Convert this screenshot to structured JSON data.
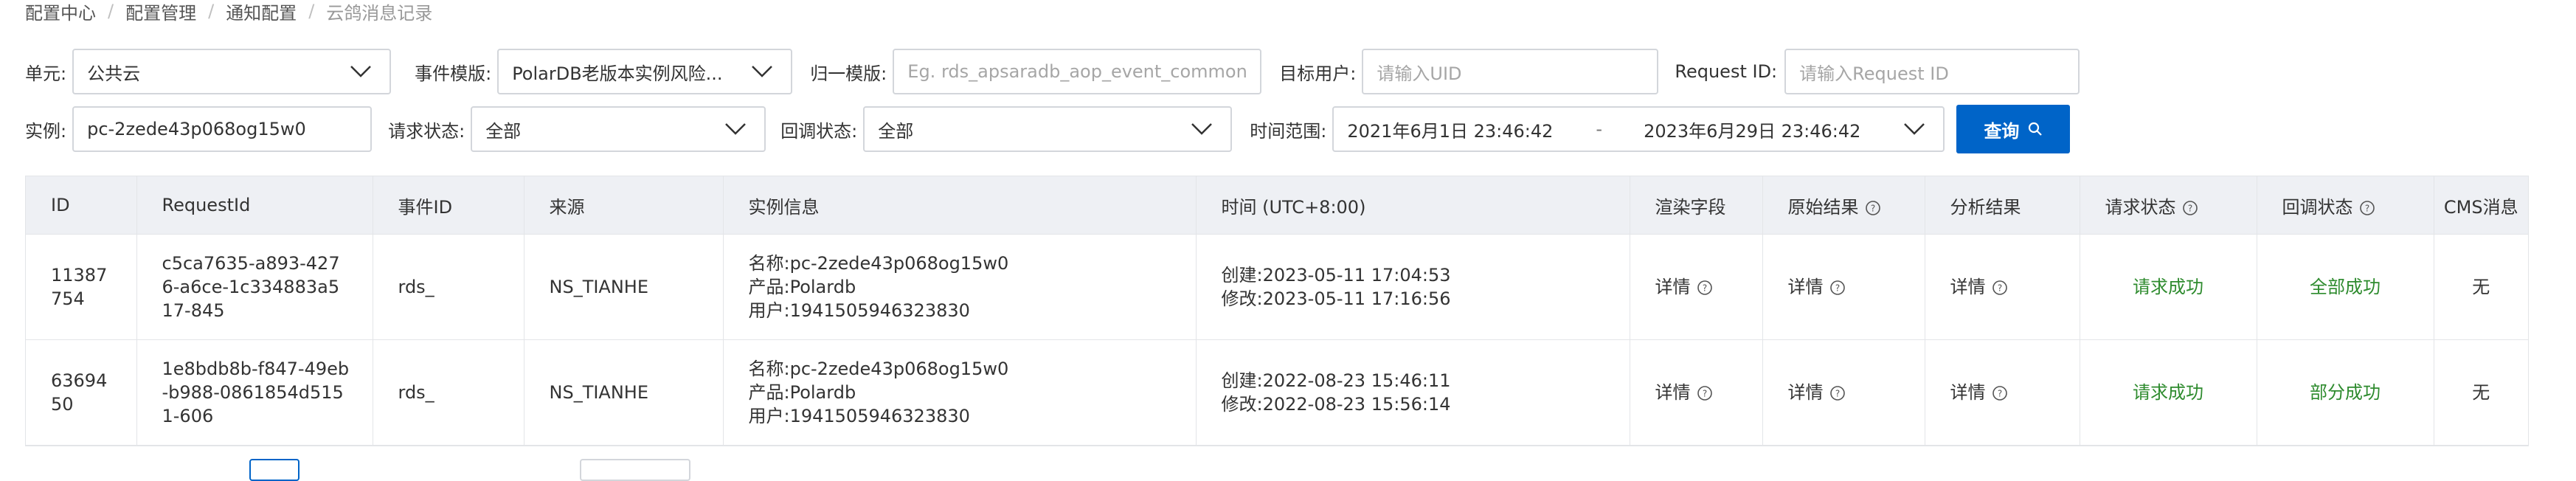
{
  "breadcrumb": [
    "配置中心",
    "配置管理",
    "通知配置",
    "云鸽消息记录"
  ],
  "filters": {
    "unit": {
      "label": "单元:",
      "value": "公共云"
    },
    "event_template": {
      "label": "事件模版:",
      "value": "PolarDB老版本实例风险..."
    },
    "normalize_template": {
      "label": "归一模版:",
      "placeholder": "Eg. rds_apsaradb_aop_event_common"
    },
    "target_user": {
      "label": "目标用户:",
      "placeholder": "请输入UID"
    },
    "request_id": {
      "label": "Request ID:",
      "placeholder": "请输入Request ID"
    },
    "instance": {
      "label": "实例:",
      "value": "pc-2zede43p068og15w0"
    },
    "request_status": {
      "label": "请求状态:",
      "value": "全部"
    },
    "callback_status": {
      "label": "回调状态:",
      "value": "全部"
    },
    "time_range": {
      "label": "时间范围:",
      "start": "2021年6月1日 23:46:42",
      "sep": "-",
      "end": "2023年6月29日 23:46:42"
    },
    "query_button": "查询"
  },
  "table": {
    "headers": [
      "ID",
      "RequestId",
      "事件ID",
      "来源",
      "实例信息",
      "时间 (UTC+8:00)",
      "渲染字段",
      "原始结果",
      "分析结果",
      "请求状态",
      "回调状态",
      "CMS消息"
    ],
    "rows": [
      {
        "id": "11387754",
        "request_id": "c5ca7635-a893-4276-a6ce-1c334883a517-845",
        "event_id": "rds_",
        "source": "NS_TIANHE",
        "instance_name": "名称:pc-2zede43p068og15w0",
        "instance_product": "产品:Polardb",
        "instance_user": "用户:1941505946323830",
        "created": "创建:2023-05-11 17:04:53",
        "modified": "修改:2023-05-11 17:16:56",
        "render": "详情",
        "raw": "详情",
        "analysis": "详情",
        "request_status": "请求成功",
        "callback_status": "全部成功",
        "cms": "无"
      },
      {
        "id": "6369450",
        "request_id": "1e8bdb8b-f847-49eb-b988-0861854d5151-606",
        "event_id": "rds_",
        "source": "NS_TIANHE",
        "instance_name": "名称:pc-2zede43p068og15w0",
        "instance_product": "产品:Polardb",
        "instance_user": "用户:1941505946323830",
        "created": "创建:2022-08-23 15:46:11",
        "modified": "修改:2022-08-23 15:56:14",
        "render": "详情",
        "raw": "详情",
        "analysis": "详情",
        "request_status": "请求成功",
        "callback_status": "部分成功",
        "cms": "无"
      }
    ]
  },
  "colors": {
    "primary": "#0064c8",
    "success": "#2e8b2e",
    "header_bg": "#eef0f4",
    "border": "#d3d6db"
  },
  "icons": [
    "chevron-down-icon",
    "search-icon",
    "help-circle-icon"
  ]
}
